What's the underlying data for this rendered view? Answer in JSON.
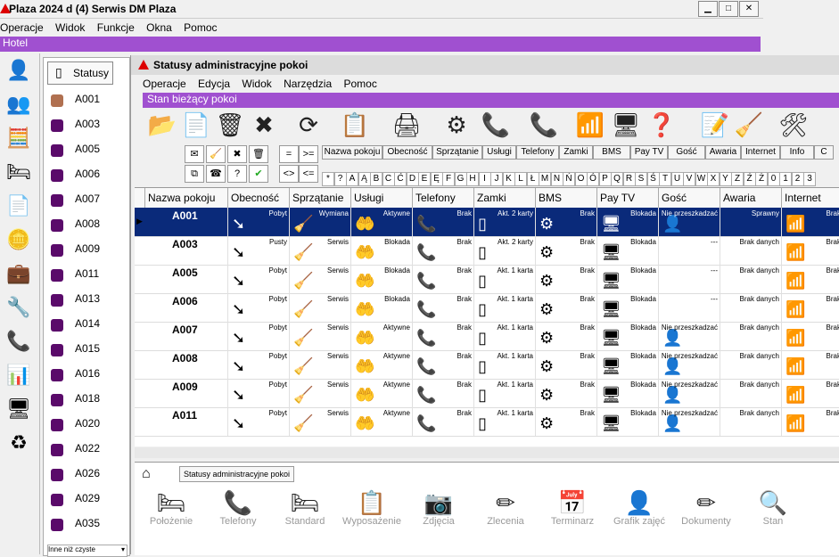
{
  "outer": {
    "title": "Plaza 2024 d (4) Serwis DM Plaza",
    "menu": [
      "Operacje",
      "Widok",
      "Funkcje",
      "Okna",
      "Pomoc"
    ],
    "banner": "Hotel"
  },
  "left_panel": {
    "tab_label": "Statusy",
    "rooms": [
      {
        "label": "A001",
        "status_color": "#b07050"
      },
      {
        "label": "A003",
        "status_color": "#5a0a6a"
      },
      {
        "label": "A005",
        "status_color": "#5a0a6a"
      },
      {
        "label": "A006",
        "status_color": "#5a0a6a"
      },
      {
        "label": "A007",
        "status_color": "#5a0a6a"
      },
      {
        "label": "A008",
        "status_color": "#5a0a6a"
      },
      {
        "label": "A009",
        "status_color": "#5a0a6a"
      },
      {
        "label": "A011",
        "status_color": "#5a0a6a"
      },
      {
        "label": "A013",
        "status_color": "#5a0a6a"
      },
      {
        "label": "A014",
        "status_color": "#5a0a6a"
      },
      {
        "label": "A015",
        "status_color": "#5a0a6a"
      },
      {
        "label": "A016",
        "status_color": "#5a0a6a"
      },
      {
        "label": "A018",
        "status_color": "#5a0a6a"
      },
      {
        "label": "A020",
        "status_color": "#5a0a6a"
      },
      {
        "label": "A022",
        "status_color": "#5a0a6a"
      },
      {
        "label": "A026",
        "status_color": "#5a0a6a"
      },
      {
        "label": "A029",
        "status_color": "#5a0a6a"
      },
      {
        "label": "A035",
        "status_color": "#5a0a6a"
      }
    ],
    "filter_select": "Inne niż czyste"
  },
  "inner": {
    "title": "Statusy administracyjne pokoi",
    "menu": [
      "Operacje",
      "Edycja",
      "Widok",
      "Narzędzia",
      "Pomoc"
    ],
    "banner": "Stan bieżący pokoi",
    "filter_tabs": [
      "Nazwa pokoju",
      "Obecność",
      "Sprzątanie",
      "Usługi",
      "Telefony",
      "Zamki",
      "BMS",
      "Pay TV",
      "Gość",
      "Awaria",
      "Internet",
      "Info",
      "C"
    ],
    "alphabet": [
      "*",
      "?",
      "A",
      "Ą",
      "B",
      "C",
      "Ć",
      "D",
      "E",
      "Ę",
      "F",
      "G",
      "H",
      "I",
      "J",
      "K",
      "L",
      "Ł",
      "M",
      "N",
      "Ń",
      "O",
      "Ó",
      "P",
      "Q",
      "R",
      "S",
      "Ś",
      "T",
      "U",
      "V",
      "W",
      "X",
      "Y",
      "Z",
      "Ź",
      "Ż",
      "0",
      "1",
      "2",
      "3"
    ],
    "small_ops": [
      "=",
      ">=",
      "<>",
      "<="
    ],
    "columns": [
      "Nazwa pokoju",
      "Obecność",
      "Sprzątanie",
      "Usługi",
      "Telefony",
      "Zamki",
      "BMS",
      "Pay TV",
      "Gość",
      "Awaria",
      "Internet"
    ],
    "rows": [
      {
        "name": "A001",
        "obecnosc": "Pobyt",
        "sprzatanie": "Wymiana",
        "uslugi": "Aktywne",
        "tel": "Brak",
        "zamki": "Akt. 2 karty",
        "bms": "Brak",
        "paytv": "Blokada",
        "gosc": "Nie przeszkadzać",
        "awaria": "Sprawny",
        "internet": "Brak"
      },
      {
        "name": "A003",
        "obecnosc": "Pusty",
        "sprzatanie": "Serwis",
        "uslugi": "Blokada",
        "tel": "Brak",
        "zamki": "Akt. 2 karty",
        "bms": "Brak",
        "paytv": "Blokada",
        "gosc": "---",
        "awaria": "Brak danych",
        "internet": "Brak"
      },
      {
        "name": "A005",
        "obecnosc": "Pobyt",
        "sprzatanie": "Serwis",
        "uslugi": "Blokada",
        "tel": "Brak",
        "zamki": "Akt. 1 karta",
        "bms": "Brak",
        "paytv": "Blokada",
        "gosc": "---",
        "awaria": "Brak danych",
        "internet": "Brak"
      },
      {
        "name": "A006",
        "obecnosc": "Pobyt",
        "sprzatanie": "Serwis",
        "uslugi": "Blokada",
        "tel": "Brak",
        "zamki": "Akt. 1 karta",
        "bms": "Brak",
        "paytv": "Blokada",
        "gosc": "---",
        "awaria": "Brak danych",
        "internet": "Brak"
      },
      {
        "name": "A007",
        "obecnosc": "Pobyt",
        "sprzatanie": "Serwis",
        "uslugi": "Aktywne",
        "tel": "Brak",
        "zamki": "Akt. 1 karta",
        "bms": "Brak",
        "paytv": "Blokada",
        "gosc": "Nie przeszkadzać",
        "awaria": "Brak danych",
        "internet": "Brak"
      },
      {
        "name": "A008",
        "obecnosc": "Pobyt",
        "sprzatanie": "Serwis",
        "uslugi": "Aktywne",
        "tel": "Brak",
        "zamki": "Akt. 1 karta",
        "bms": "Brak",
        "paytv": "Blokada",
        "gosc": "Nie przeszkadzać",
        "awaria": "Brak danych",
        "internet": "Brak"
      },
      {
        "name": "A009",
        "obecnosc": "Pobyt",
        "sprzatanie": "Serwis",
        "uslugi": "Aktywne",
        "tel": "Brak",
        "zamki": "Akt. 1 karta",
        "bms": "Brak",
        "paytv": "Blokada",
        "gosc": "Nie przeszkadzać",
        "awaria": "Brak danych",
        "internet": "Brak"
      },
      {
        "name": "A011",
        "obecnosc": "Pobyt",
        "sprzatanie": "Serwis",
        "uslugi": "Aktywne",
        "tel": "Brak",
        "zamki": "Akt. 1 karta",
        "bms": "Brak",
        "paytv": "Blokada",
        "gosc": "Nie przeszkadzać",
        "awaria": "Brak danych",
        "internet": "Brak"
      }
    ],
    "bottom_tab": "Statusy administracyjne pokoi",
    "bottom_tools": [
      "Położenie",
      "Telefony",
      "Standard",
      "Wyposażenie",
      "Zdjęcia",
      "Zlecenia",
      "Terminarz",
      "Grafik zajęć",
      "Dokumenty",
      "Stan"
    ]
  },
  "colors": {
    "accent": "#a050d0",
    "selection": "#0a2a7a",
    "room_default": "#5a0a6a",
    "room_first": "#b07050"
  }
}
